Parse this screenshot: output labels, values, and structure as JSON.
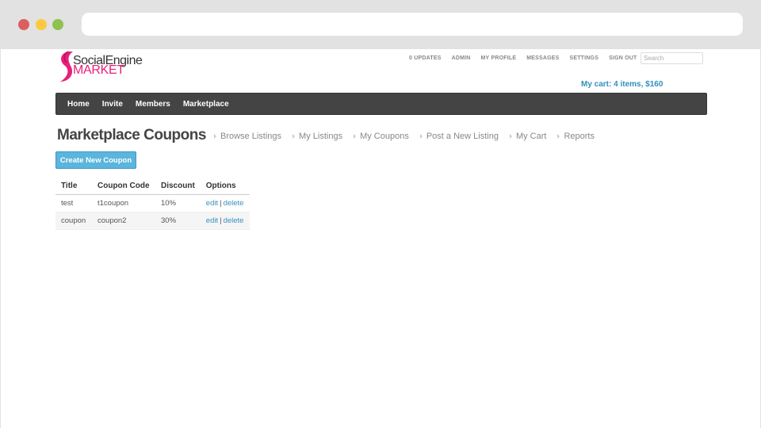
{
  "browser": {
    "url": ""
  },
  "logo": {
    "line1": "SocialEngine",
    "line2": "MARKET"
  },
  "mini_nav": {
    "items": [
      "0 UPDATES",
      "ADMIN",
      "MY PROFILE",
      "MESSAGES",
      "SETTINGS",
      "SIGN OUT"
    ],
    "search_placeholder": "Search"
  },
  "cart": {
    "label": "My cart: 4 items, $160"
  },
  "main_nav": {
    "items": [
      "Home",
      "Invite",
      "Members",
      "Marketplace"
    ]
  },
  "page": {
    "title": "Marketplace Coupons",
    "create_button": "Create New Coupon"
  },
  "sub_nav": {
    "items": [
      "Browse Listings",
      "My Listings",
      "My Coupons",
      "Post a New Listing",
      "My Cart",
      "Reports"
    ]
  },
  "table": {
    "headers": [
      "Title",
      "Coupon Code",
      "Discount",
      "Options"
    ],
    "rows": [
      {
        "title": "test",
        "code": "t1coupon",
        "discount": "10%",
        "edit": "edit",
        "sep": "|",
        "delete": "delete"
      },
      {
        "title": "coupon",
        "code": "coupon2",
        "discount": "30%",
        "edit": "edit",
        "sep": "|",
        "delete": "delete"
      }
    ]
  },
  "colors": {
    "accent": "#2f8fbd",
    "brand_pink": "#e8207a",
    "nav_bg": "#444444",
    "button_bg": "#5bb5dc"
  }
}
